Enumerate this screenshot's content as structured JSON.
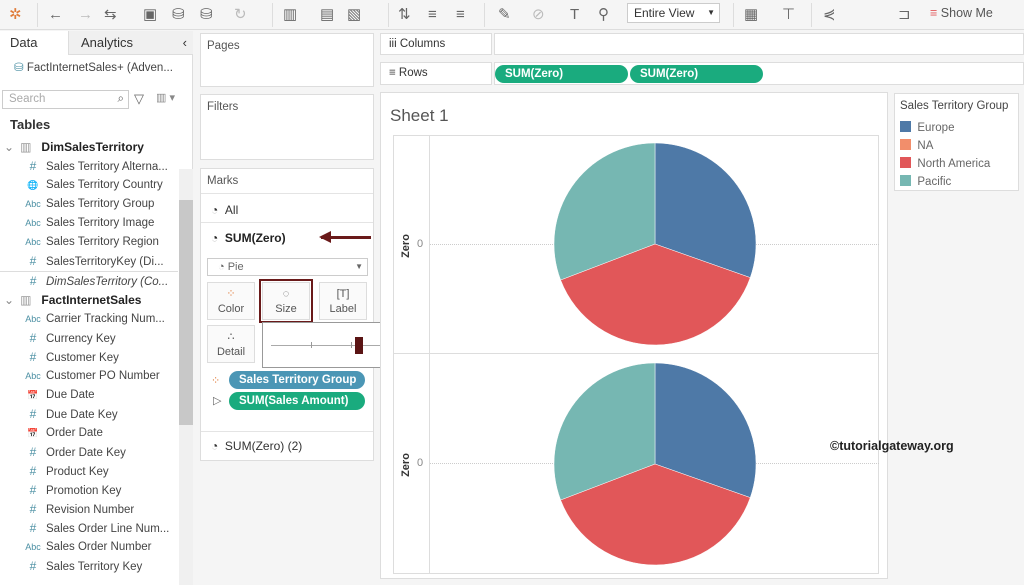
{
  "toolbar": {
    "view_select": "Entire View",
    "show_me": "Show Me"
  },
  "left_pane": {
    "tabs": [
      "Data",
      "Analytics"
    ],
    "datasource": "FactInternetSales+ (Adven...",
    "search_placeholder": "Search",
    "tables_heading": "Tables",
    "tables": [
      {
        "name": "DimSalesTerritory",
        "fields": [
          {
            "type": "#",
            "label": "Sales Territory Alterna..."
          },
          {
            "type": "geo",
            "label": "Sales Territory Country"
          },
          {
            "type": "Abc",
            "label": "Sales Territory Group"
          },
          {
            "type": "Abc",
            "label": "Sales Territory Image"
          },
          {
            "type": "Abc",
            "label": "Sales Territory Region"
          },
          {
            "type": "#",
            "label": "SalesTerritoryKey (Di..."
          },
          {
            "type": "#",
            "label": "DimSalesTerritory (Co..."
          }
        ]
      },
      {
        "name": "FactInternetSales",
        "fields": [
          {
            "type": "Abc",
            "label": "Carrier Tracking Num..."
          },
          {
            "type": "#",
            "label": "Currency Key"
          },
          {
            "type": "#",
            "label": "Customer Key"
          },
          {
            "type": "Abc",
            "label": "Customer PO Number"
          },
          {
            "type": "date",
            "label": "Due Date"
          },
          {
            "type": "#",
            "label": "Due Date Key"
          },
          {
            "type": "date",
            "label": "Order Date"
          },
          {
            "type": "#",
            "label": "Order Date Key"
          },
          {
            "type": "#",
            "label": "Product Key"
          },
          {
            "type": "#",
            "label": "Promotion Key"
          },
          {
            "type": "#",
            "label": "Revision Number"
          },
          {
            "type": "#",
            "label": "Sales Order Line Num..."
          },
          {
            "type": "Abc",
            "label": "Sales Order Number"
          },
          {
            "type": "#",
            "label": "Sales Territory Key"
          }
        ]
      }
    ]
  },
  "shelves": {
    "pages": "Pages",
    "filters": "Filters",
    "columns": "Columns",
    "rows": "Rows",
    "row_pills": [
      "SUM(Zero)",
      "SUM(Zero)"
    ]
  },
  "marks": {
    "title": "Marks",
    "all": "All",
    "layer1": "SUM(Zero)",
    "mark_type": "Pie",
    "buttons": [
      "Color",
      "Size",
      "Label",
      "Detail"
    ],
    "pills": [
      "Sales Territory Group",
      "SUM(Sales Amount)"
    ],
    "layer2": "SUM(Zero) (2)",
    "size_slider": 0.55
  },
  "sheet": {
    "title": "Sheet 1",
    "axis_label": "Zero",
    "axis_tick": "0",
    "watermark": "©tutorialgateway.org"
  },
  "legend": {
    "title": "Sales Territory Group",
    "items": [
      {
        "label": "Europe",
        "color": "#4e79a7"
      },
      {
        "label": "NA",
        "color": "#f28e6b"
      },
      {
        "label": "North America",
        "color": "#e15759"
      },
      {
        "label": "Pacific",
        "color": "#76b7b2"
      }
    ]
  },
  "chart_data": {
    "type": "pie",
    "categories": [
      "Europe",
      "NA",
      "North America",
      "Pacific"
    ],
    "values": [
      30.4,
      0,
      38.8,
      30.8
    ],
    "unit": "percent of SUM(Sales Amount)",
    "panes": 2
  }
}
